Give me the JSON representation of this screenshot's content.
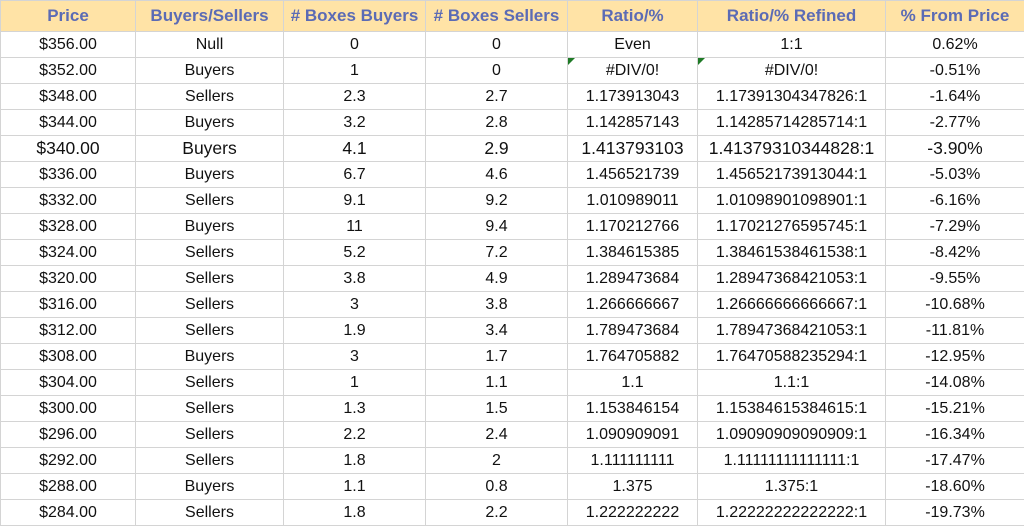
{
  "headers": {
    "price": "Price",
    "buyers_sellers": "Buyers/Sellers",
    "boxes_buyers": "# Boxes Buyers",
    "boxes_sellers": "# Boxes Sellers",
    "ratio": "Ratio/%",
    "ratio_refined": "Ratio/% Refined",
    "from_price": "% From Price"
  },
  "colors": {
    "header_bg": "#ffe3a6",
    "header_text": "#5b6bb5",
    "buyers_bg": "#c8edce",
    "buyers_text": "#1a6e1f",
    "sellers_bg": "#ffc7ce",
    "sellers_text": "#9c0a14",
    "null_bg": "#ffec9c",
    "null_text": "#a8650a",
    "error_flag": "#1e7a26"
  },
  "rows": [
    {
      "price": "$356.00",
      "side": "Null",
      "boxes_buyers": "0",
      "boxes_sellers": "0",
      "ratio": "Even",
      "ratio_refined": "1:1",
      "from_price": "0.62%"
    },
    {
      "price": "$352.00",
      "side": "Buyers",
      "boxes_buyers": "1",
      "boxes_sellers": "0",
      "ratio": "#DIV/0!",
      "ratio_refined": "#DIV/0!",
      "from_price": "-0.51%"
    },
    {
      "price": "$348.00",
      "side": "Sellers",
      "boxes_buyers": "2.3",
      "boxes_sellers": "2.7",
      "ratio": "1.173913043",
      "ratio_refined": "1.17391304347826:1",
      "from_price": "-1.64%"
    },
    {
      "price": "$344.00",
      "side": "Buyers",
      "boxes_buyers": "3.2",
      "boxes_sellers": "2.8",
      "ratio": "1.142857143",
      "ratio_refined": "1.14285714285714:1",
      "from_price": "-2.77%"
    },
    {
      "price": "$340.00",
      "side": "Buyers",
      "boxes_buyers": "4.1",
      "boxes_sellers": "2.9",
      "ratio": "1.413793103",
      "ratio_refined": "1.41379310344828:1",
      "from_price": "-3.90%"
    },
    {
      "price": "$336.00",
      "side": "Buyers",
      "boxes_buyers": "6.7",
      "boxes_sellers": "4.6",
      "ratio": "1.456521739",
      "ratio_refined": "1.45652173913044:1",
      "from_price": "-5.03%"
    },
    {
      "price": "$332.00",
      "side": "Sellers",
      "boxes_buyers": "9.1",
      "boxes_sellers": "9.2",
      "ratio": "1.010989011",
      "ratio_refined": "1.01098901098901:1",
      "from_price": "-6.16%"
    },
    {
      "price": "$328.00",
      "side": "Buyers",
      "boxes_buyers": "11",
      "boxes_sellers": "9.4",
      "ratio": "1.170212766",
      "ratio_refined": "1.17021276595745:1",
      "from_price": "-7.29%"
    },
    {
      "price": "$324.00",
      "side": "Sellers",
      "boxes_buyers": "5.2",
      "boxes_sellers": "7.2",
      "ratio": "1.384615385",
      "ratio_refined": "1.38461538461538:1",
      "from_price": "-8.42%"
    },
    {
      "price": "$320.00",
      "side": "Sellers",
      "boxes_buyers": "3.8",
      "boxes_sellers": "4.9",
      "ratio": "1.289473684",
      "ratio_refined": "1.28947368421053:1",
      "from_price": "-9.55%"
    },
    {
      "price": "$316.00",
      "side": "Sellers",
      "boxes_buyers": "3",
      "boxes_sellers": "3.8",
      "ratio": "1.266666667",
      "ratio_refined": "1.26666666666667:1",
      "from_price": "-10.68%"
    },
    {
      "price": "$312.00",
      "side": "Sellers",
      "boxes_buyers": "1.9",
      "boxes_sellers": "3.4",
      "ratio": "1.789473684",
      "ratio_refined": "1.78947368421053:1",
      "from_price": "-11.81%"
    },
    {
      "price": "$308.00",
      "side": "Buyers",
      "boxes_buyers": "3",
      "boxes_sellers": "1.7",
      "ratio": "1.764705882",
      "ratio_refined": "1.76470588235294:1",
      "from_price": "-12.95%"
    },
    {
      "price": "$304.00",
      "side": "Sellers",
      "boxes_buyers": "1",
      "boxes_sellers": "1.1",
      "ratio": "1.1",
      "ratio_refined": "1.1:1",
      "from_price": "-14.08%"
    },
    {
      "price": "$300.00",
      "side": "Sellers",
      "boxes_buyers": "1.3",
      "boxes_sellers": "1.5",
      "ratio": "1.153846154",
      "ratio_refined": "1.15384615384615:1",
      "from_price": "-15.21%"
    },
    {
      "price": "$296.00",
      "side": "Sellers",
      "boxes_buyers": "2.2",
      "boxes_sellers": "2.4",
      "ratio": "1.090909091",
      "ratio_refined": "1.09090909090909:1",
      "from_price": "-16.34%"
    },
    {
      "price": "$292.00",
      "side": "Sellers",
      "boxes_buyers": "1.8",
      "boxes_sellers": "2",
      "ratio": "1.111111111",
      "ratio_refined": "1.11111111111111:1",
      "from_price": "-17.47%"
    },
    {
      "price": "$288.00",
      "side": "Buyers",
      "boxes_buyers": "1.1",
      "boxes_sellers": "0.8",
      "ratio": "1.375",
      "ratio_refined": "1.375:1",
      "from_price": "-18.60%"
    },
    {
      "price": "$284.00",
      "side": "Sellers",
      "boxes_buyers": "1.8",
      "boxes_sellers": "2.2",
      "ratio": "1.222222222",
      "ratio_refined": "1.22222222222222:1",
      "from_price": "-19.73%"
    }
  ]
}
